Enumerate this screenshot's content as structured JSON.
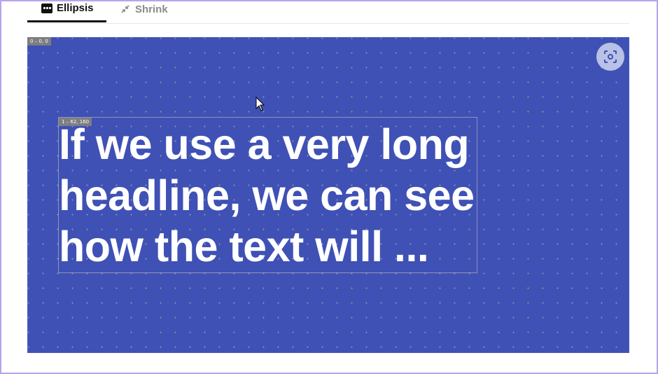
{
  "tabs": [
    {
      "label": "Ellipsis",
      "icon": "ellipsis-icon",
      "active": true
    },
    {
      "label": "Shrink",
      "icon": "shrink-icon",
      "active": false
    }
  ],
  "canvas": {
    "background": "#3f51b5",
    "root_badge": "0 – 0, 0",
    "text_badge": "1 – 62, 160",
    "headline": "If we use a very long\nheadline, we can see\nhow the text will ...",
    "focus_button_icon": "center-focus-icon"
  },
  "colors": {
    "accent": "#3f51b5",
    "frame_border": "#b9a3ec",
    "active_tab_underline": "#111111",
    "inactive_tab": "#8b8b8b"
  }
}
